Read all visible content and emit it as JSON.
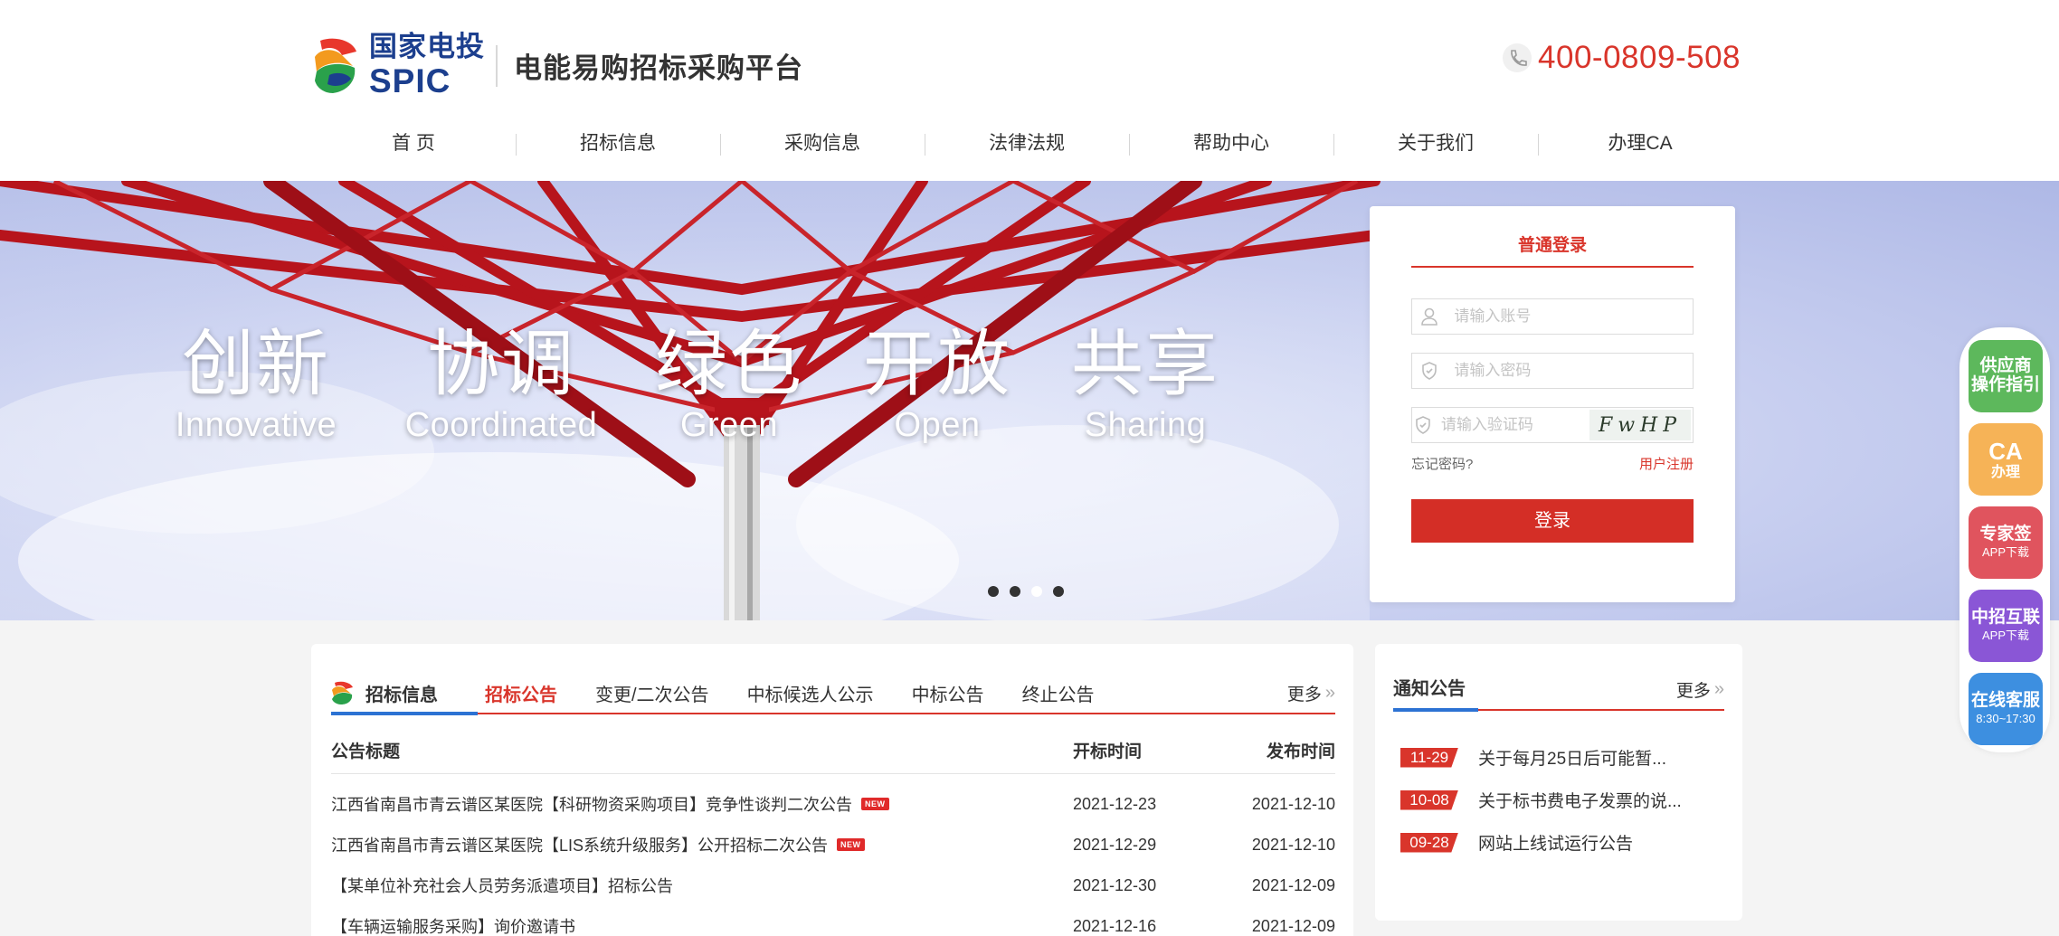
{
  "header": {
    "brand_cn": "国家电投",
    "brand_en": "SPIC",
    "platform_title": "电能易购招标采购平台",
    "hotline": "400-0809-508"
  },
  "nav": [
    "首 页",
    "招标信息",
    "采购信息",
    "法律法规",
    "帮助中心",
    "关于我们",
    "办理CA"
  ],
  "banner": {
    "slogans": [
      {
        "cn": "创新",
        "en": "Innovative"
      },
      {
        "cn": "协调",
        "en": "Coordinated"
      },
      {
        "cn": "绿色",
        "en": "Green"
      },
      {
        "cn": "开放",
        "en": "Open"
      },
      {
        "cn": "共享",
        "en": "Sharing"
      }
    ],
    "slide_count": 4,
    "active_slide": 3
  },
  "login": {
    "tab_label": "普通登录",
    "account_placeholder": "请输入账号",
    "password_placeholder": "请输入密码",
    "captcha_placeholder": "请输入验证码",
    "captcha_text": "FwHP",
    "forgot_label": "忘记密码?",
    "register_label": "用户注册",
    "submit_label": "登录"
  },
  "bidding": {
    "section_title": "招标信息",
    "tabs": [
      "招标公告",
      "变更/二次公告",
      "中标候选人公示",
      "中标公告",
      "终止公告"
    ],
    "active_tab": 0,
    "more_label": "更多",
    "columns": {
      "title": "公告标题",
      "open_time": "开标时间",
      "publish_time": "发布时间"
    },
    "new_label": "NEW",
    "rows": [
      {
        "title": "江西省南昌市青云谱区某医院【科研物资采购项目】竞争性谈判二次公告",
        "open_time": "2021-12-23",
        "publish_time": "2021-12-10",
        "is_new": true
      },
      {
        "title": "江西省南昌市青云谱区某医院【LIS系统升级服务】公开招标二次公告",
        "open_time": "2021-12-29",
        "publish_time": "2021-12-10",
        "is_new": true
      },
      {
        "title": "【某单位补充社会人员劳务派遣项目】招标公告",
        "open_time": "2021-12-30",
        "publish_time": "2021-12-09",
        "is_new": false
      },
      {
        "title": "【车辆运输服务采购】询价邀请书",
        "open_time": "2021-12-16",
        "publish_time": "2021-12-09",
        "is_new": false
      }
    ]
  },
  "notice": {
    "title": "通知公告",
    "more_label": "更多",
    "items": [
      {
        "date": "11-29",
        "text": "关于每月25日后可能暂..."
      },
      {
        "date": "10-08",
        "text": "关于标书费电子发票的说..."
      },
      {
        "date": "09-28",
        "text": "网站上线试运行公告"
      }
    ]
  },
  "sidebar": [
    {
      "line1": "供应商",
      "line2": "操作指引",
      "color": "#5db85c",
      "style": "text"
    },
    {
      "line1": "CA",
      "line2": "办理",
      "color": "#f6b357",
      "style": "big"
    },
    {
      "line1": "专家签",
      "line2": "APP下载",
      "color": "#e0545e",
      "style": "app"
    },
    {
      "line1": "中招互联",
      "line2": "APP下载",
      "color": "#8a56d6",
      "style": "app"
    },
    {
      "line1": "在线客服",
      "line2": "8:30~17:30",
      "color": "#3d8fe0",
      "style": "app"
    }
  ],
  "colors": {
    "brand_red": "#d9352b",
    "brand_blue": "#1c3f8e",
    "accent_blue": "#2c72d3"
  }
}
